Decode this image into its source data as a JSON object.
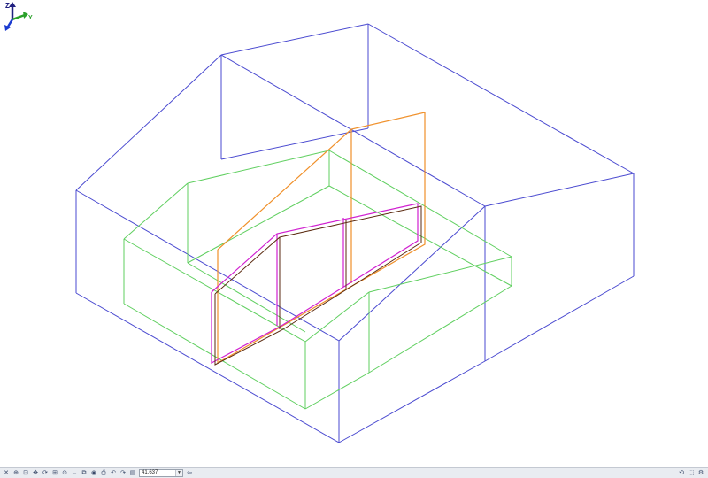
{
  "viewport": {
    "edge_colors": {
      "blue": "#4a4ad0",
      "green": "#5fcf5f",
      "orange": "#f0902a",
      "magenta": "#d020d0",
      "brown": "#5a2a10"
    }
  },
  "triad": {
    "z_label": "Z",
    "y_label": "Y",
    "colors": {
      "x": "#1a3ad0",
      "y": "#2aa02a",
      "z": "#202080"
    }
  },
  "statusbar": {
    "left_tools": [
      {
        "name": "close-view-icon",
        "glyph": "✕"
      },
      {
        "name": "zoom-icon",
        "glyph": "⊕"
      },
      {
        "name": "zoom-area-icon",
        "glyph": "⊡"
      },
      {
        "name": "pan-icon",
        "glyph": "✥"
      },
      {
        "name": "rotate-icon",
        "glyph": "⟳"
      },
      {
        "name": "fit-view-icon",
        "glyph": "⊞"
      },
      {
        "name": "view-center-icon",
        "glyph": "⊙"
      },
      {
        "name": "arrow-left-icon",
        "glyph": "←"
      },
      {
        "name": "select-view-icon",
        "glyph": "⧉"
      },
      {
        "name": "render-icon",
        "glyph": "◉"
      },
      {
        "name": "print-icon",
        "glyph": "⎙"
      },
      {
        "name": "undo-view-icon",
        "glyph": "↶"
      },
      {
        "name": "redo-view-icon",
        "glyph": "↷"
      },
      {
        "name": "layers-icon",
        "glyph": "▤"
      }
    ],
    "coordinate_value": "41.637",
    "after_tools": [
      {
        "name": "go-icon",
        "glyph": "⇦"
      }
    ],
    "right_tools": [
      {
        "name": "sync-icon",
        "glyph": "⟲"
      },
      {
        "name": "cube-view-icon",
        "glyph": "⬚"
      },
      {
        "name": "settings-icon",
        "glyph": "⚙"
      }
    ]
  }
}
